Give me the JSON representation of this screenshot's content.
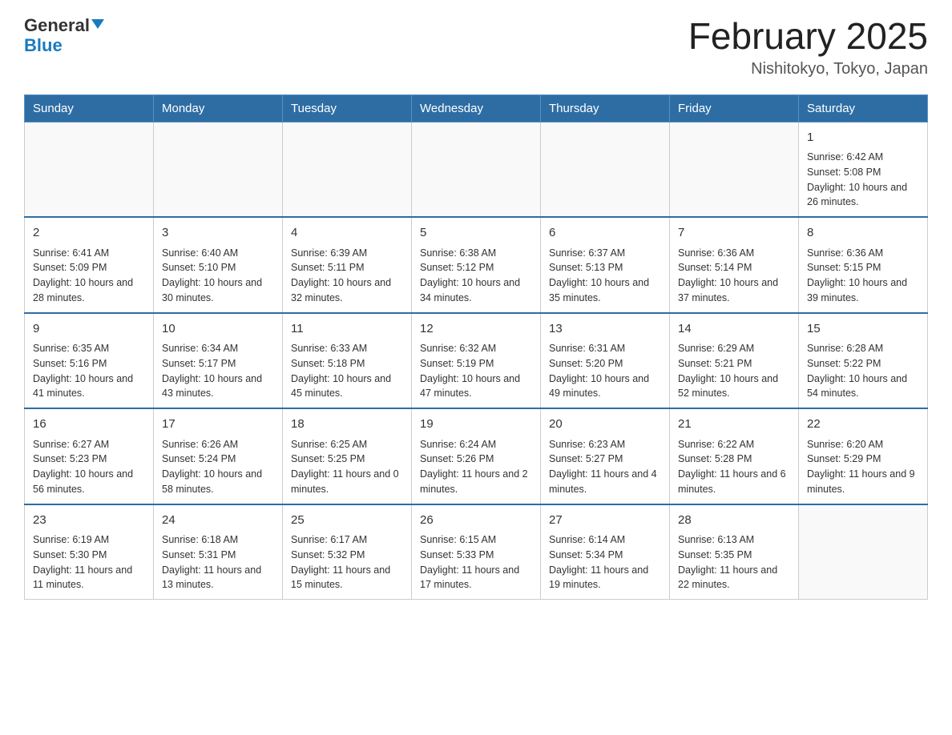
{
  "header": {
    "logo_general": "General",
    "logo_blue": "Blue",
    "month_title": "February 2025",
    "location": "Nishitokyo, Tokyo, Japan"
  },
  "calendar": {
    "days_of_week": [
      "Sunday",
      "Monday",
      "Tuesday",
      "Wednesday",
      "Thursday",
      "Friday",
      "Saturday"
    ],
    "weeks": [
      [
        {
          "day": "",
          "info": ""
        },
        {
          "day": "",
          "info": ""
        },
        {
          "day": "",
          "info": ""
        },
        {
          "day": "",
          "info": ""
        },
        {
          "day": "",
          "info": ""
        },
        {
          "day": "",
          "info": ""
        },
        {
          "day": "1",
          "info": "Sunrise: 6:42 AM\nSunset: 5:08 PM\nDaylight: 10 hours and 26 minutes."
        }
      ],
      [
        {
          "day": "2",
          "info": "Sunrise: 6:41 AM\nSunset: 5:09 PM\nDaylight: 10 hours and 28 minutes."
        },
        {
          "day": "3",
          "info": "Sunrise: 6:40 AM\nSunset: 5:10 PM\nDaylight: 10 hours and 30 minutes."
        },
        {
          "day": "4",
          "info": "Sunrise: 6:39 AM\nSunset: 5:11 PM\nDaylight: 10 hours and 32 minutes."
        },
        {
          "day": "5",
          "info": "Sunrise: 6:38 AM\nSunset: 5:12 PM\nDaylight: 10 hours and 34 minutes."
        },
        {
          "day": "6",
          "info": "Sunrise: 6:37 AM\nSunset: 5:13 PM\nDaylight: 10 hours and 35 minutes."
        },
        {
          "day": "7",
          "info": "Sunrise: 6:36 AM\nSunset: 5:14 PM\nDaylight: 10 hours and 37 minutes."
        },
        {
          "day": "8",
          "info": "Sunrise: 6:36 AM\nSunset: 5:15 PM\nDaylight: 10 hours and 39 minutes."
        }
      ],
      [
        {
          "day": "9",
          "info": "Sunrise: 6:35 AM\nSunset: 5:16 PM\nDaylight: 10 hours and 41 minutes."
        },
        {
          "day": "10",
          "info": "Sunrise: 6:34 AM\nSunset: 5:17 PM\nDaylight: 10 hours and 43 minutes."
        },
        {
          "day": "11",
          "info": "Sunrise: 6:33 AM\nSunset: 5:18 PM\nDaylight: 10 hours and 45 minutes."
        },
        {
          "day": "12",
          "info": "Sunrise: 6:32 AM\nSunset: 5:19 PM\nDaylight: 10 hours and 47 minutes."
        },
        {
          "day": "13",
          "info": "Sunrise: 6:31 AM\nSunset: 5:20 PM\nDaylight: 10 hours and 49 minutes."
        },
        {
          "day": "14",
          "info": "Sunrise: 6:29 AM\nSunset: 5:21 PM\nDaylight: 10 hours and 52 minutes."
        },
        {
          "day": "15",
          "info": "Sunrise: 6:28 AM\nSunset: 5:22 PM\nDaylight: 10 hours and 54 minutes."
        }
      ],
      [
        {
          "day": "16",
          "info": "Sunrise: 6:27 AM\nSunset: 5:23 PM\nDaylight: 10 hours and 56 minutes."
        },
        {
          "day": "17",
          "info": "Sunrise: 6:26 AM\nSunset: 5:24 PM\nDaylight: 10 hours and 58 minutes."
        },
        {
          "day": "18",
          "info": "Sunrise: 6:25 AM\nSunset: 5:25 PM\nDaylight: 11 hours and 0 minutes."
        },
        {
          "day": "19",
          "info": "Sunrise: 6:24 AM\nSunset: 5:26 PM\nDaylight: 11 hours and 2 minutes."
        },
        {
          "day": "20",
          "info": "Sunrise: 6:23 AM\nSunset: 5:27 PM\nDaylight: 11 hours and 4 minutes."
        },
        {
          "day": "21",
          "info": "Sunrise: 6:22 AM\nSunset: 5:28 PM\nDaylight: 11 hours and 6 minutes."
        },
        {
          "day": "22",
          "info": "Sunrise: 6:20 AM\nSunset: 5:29 PM\nDaylight: 11 hours and 9 minutes."
        }
      ],
      [
        {
          "day": "23",
          "info": "Sunrise: 6:19 AM\nSunset: 5:30 PM\nDaylight: 11 hours and 11 minutes."
        },
        {
          "day": "24",
          "info": "Sunrise: 6:18 AM\nSunset: 5:31 PM\nDaylight: 11 hours and 13 minutes."
        },
        {
          "day": "25",
          "info": "Sunrise: 6:17 AM\nSunset: 5:32 PM\nDaylight: 11 hours and 15 minutes."
        },
        {
          "day": "26",
          "info": "Sunrise: 6:15 AM\nSunset: 5:33 PM\nDaylight: 11 hours and 17 minutes."
        },
        {
          "day": "27",
          "info": "Sunrise: 6:14 AM\nSunset: 5:34 PM\nDaylight: 11 hours and 19 minutes."
        },
        {
          "day": "28",
          "info": "Sunrise: 6:13 AM\nSunset: 5:35 PM\nDaylight: 11 hours and 22 minutes."
        },
        {
          "day": "",
          "info": ""
        }
      ]
    ]
  }
}
